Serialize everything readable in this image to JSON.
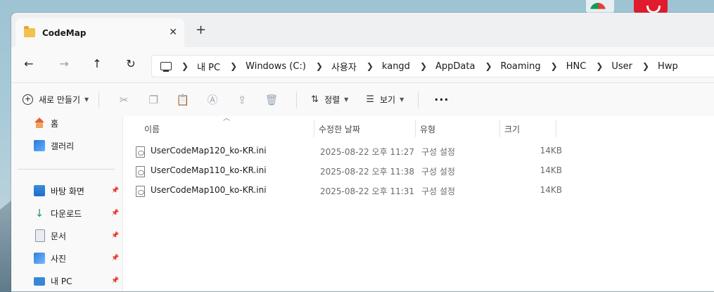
{
  "window": {
    "tab_title": "CodeMap",
    "tab_close": "✕",
    "new_tab": "+"
  },
  "nav": {
    "back": "←",
    "forward": "→",
    "up": "↑",
    "refresh": "↻"
  },
  "address": {
    "crumbs": [
      "내 PC",
      "Windows (C:)",
      "사용자",
      "kangd",
      "AppData",
      "Roaming",
      "HNC",
      "User",
      "Hwp"
    ]
  },
  "toolbar": {
    "new_label": "새로 만들기",
    "sort_label": "정렬",
    "view_label": "보기",
    "more_label": "···"
  },
  "sidebar": {
    "items": [
      {
        "label": "홈"
      },
      {
        "label": "갤러리"
      },
      {
        "label": "바탕 화면"
      },
      {
        "label": "다운로드"
      },
      {
        "label": "문서"
      },
      {
        "label": "사진"
      },
      {
        "label": "내 PC"
      }
    ]
  },
  "columns": {
    "name": "이름",
    "date": "수정한 날짜",
    "type": "유형",
    "size": "크기"
  },
  "files": [
    {
      "name": "UserCodeMap120_ko-KR.ini",
      "date": "2025-08-22 오후 11:27",
      "type": "구성 설정",
      "size": "14KB"
    },
    {
      "name": "UserCodeMap110_ko-KR.ini",
      "date": "2025-08-22 오후 11:38",
      "type": "구성 설정",
      "size": "14KB"
    },
    {
      "name": "UserCodeMap100_ko-KR.ini",
      "date": "2025-08-22 오후 11:31",
      "type": "구성 설정",
      "size": "14KB"
    }
  ]
}
